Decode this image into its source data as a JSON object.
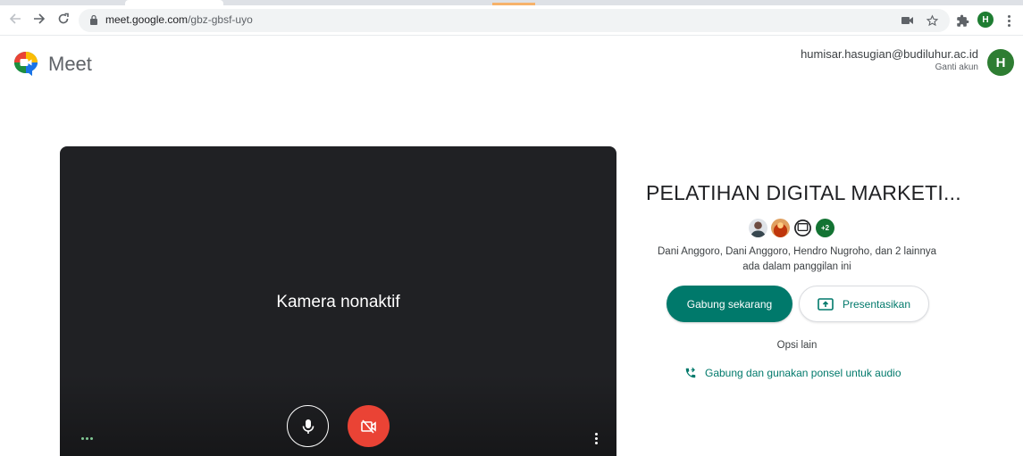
{
  "browser": {
    "url_host": "meet.google.com",
    "url_path": "/gbz-gbsf-uyo",
    "profile_initial": "H",
    "icons": [
      "back-arrow-icon",
      "forward-arrow-icon",
      "reload-icon",
      "lock-icon",
      "camera-blocked-icon",
      "star-icon",
      "extensions-icon",
      "kebab-menu-icon"
    ]
  },
  "header": {
    "app_name": "Meet",
    "account_email": "humisar.hasugian@budiluhur.ac.id",
    "switch_account": "Ganti akun",
    "avatar_initial": "H"
  },
  "preview": {
    "camera_status": "Kamera nonaktif",
    "mic_icon": "microphone-icon",
    "camera_icon": "camera-off-icon"
  },
  "join_panel": {
    "meeting_title": "PELATIHAN DIGITAL MARKETI...",
    "participant_more": "+2",
    "participants_line1": "Dani Anggoro, Dani Anggoro, Hendro Nugroho, dan 2 lainnya",
    "participants_line2": "ada dalam panggilan ini",
    "join_button": "Gabung sekarang",
    "present_button": "Presentasikan",
    "other_options": "Opsi lain",
    "phone_audio": "Gabung dan gunakan ponsel untuk audio"
  },
  "colors": {
    "accent_teal": "#00796b",
    "cam_off_red": "#ea4335",
    "avatar_green": "#2e7d32",
    "preview_bg": "#202124"
  }
}
